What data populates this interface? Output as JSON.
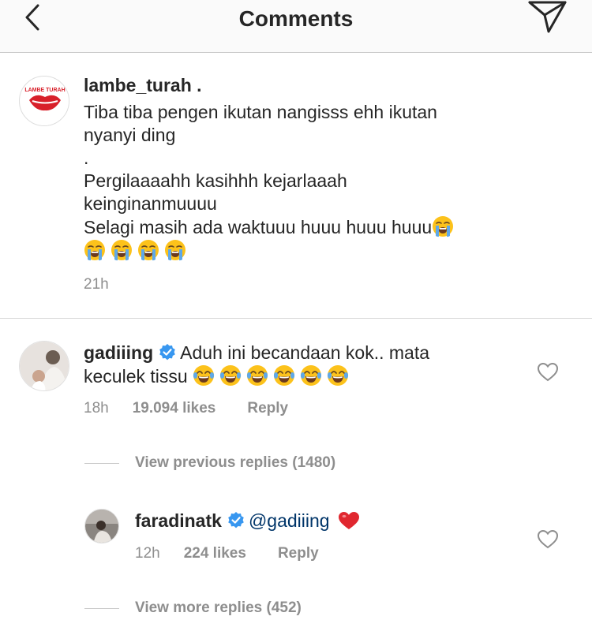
{
  "header": {
    "title": "Comments"
  },
  "caption": {
    "username": "lambe_turah .",
    "logo_text": "LAMBE TURAH",
    "text": "Tiba tiba pengen ikutan nangisss ehh ikutan\nnyanyi ding\n.\nPergilaaaahh kasihhh kejarlaaah\nkeinginanmuuuu\nSelagi masih ada waktuuu huuu huuu huuu",
    "time": "21h"
  },
  "comments": [
    {
      "username": "gadiiing",
      "text_line1": "Aduh ini becandaan kok.. mata",
      "text_line2": "keculek tissu",
      "time": "18h",
      "likes": "19.094 likes",
      "reply_label": "Reply",
      "emoji_count": 6
    }
  ],
  "view_previous": "View previous replies (1480)",
  "reply": {
    "username": "faradinatk",
    "mention": "@gadiiing",
    "time": "12h",
    "likes": "224 likes",
    "reply_label": "Reply"
  },
  "view_more": "View more replies (452)",
  "colors": {
    "text": "#262626",
    "muted": "#8e8e8e",
    "verified": "#3897f0",
    "heart_red": "#ed4956",
    "brand_red": "#d8202a"
  }
}
